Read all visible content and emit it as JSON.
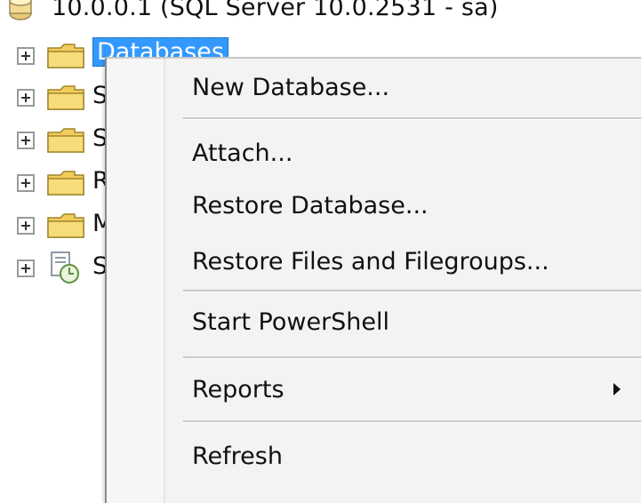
{
  "object_explorer": {
    "server_node": {
      "label": "10.0.0.1 (SQL Server 10.0.2531 - sa)",
      "icon": "server-icon"
    },
    "nodes": [
      {
        "label": "Databases",
        "icon": "folder-icon",
        "selected": true
      },
      {
        "label": "S",
        "icon": "folder-icon"
      },
      {
        "label": "S",
        "icon": "folder-icon"
      },
      {
        "label": "R",
        "icon": "folder-icon"
      },
      {
        "label": "M",
        "icon": "folder-icon"
      },
      {
        "label": "S",
        "icon": "sql-agent-icon"
      }
    ]
  },
  "context_menu": {
    "items": [
      {
        "label": "New Database..."
      },
      {
        "label": "Attach..."
      },
      {
        "label": "Restore Database..."
      },
      {
        "label": "Restore Files and Filegroups..."
      },
      {
        "label": "Start PowerShell"
      },
      {
        "label": "Reports",
        "submenu_icon": "chevron-right-icon"
      },
      {
        "label": "Refresh"
      }
    ]
  },
  "colors": {
    "selection": "#3399ff",
    "menu_background": "#f3f3f3",
    "folder": "#f2cd5c"
  }
}
